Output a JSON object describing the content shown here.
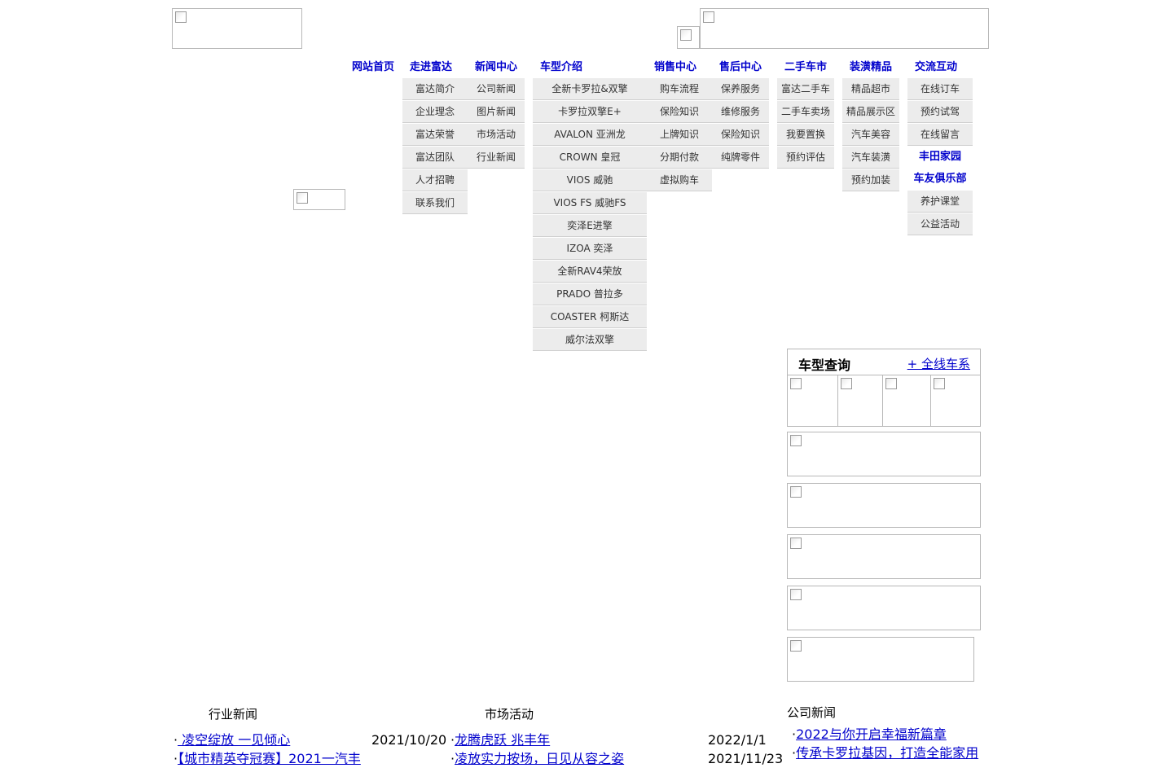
{
  "nav": {
    "top": [
      {
        "label": "网站首页"
      },
      {
        "label": "走进富达"
      },
      {
        "label": "新闻中心"
      },
      {
        "label": "车型介绍"
      },
      {
        "label": "销售中心"
      },
      {
        "label": "售后中心"
      },
      {
        "label": "二手车市"
      },
      {
        "label": "装潢精品"
      },
      {
        "label": "交流互动"
      }
    ],
    "menus": {
      "about": [
        "富达简介",
        "企业理念",
        "富达荣誉",
        "富达团队",
        "人才招聘",
        "联系我们"
      ],
      "news": [
        "公司新闻",
        "图片新闻",
        "市场活动",
        "行业新闻"
      ],
      "models": [
        "全新卡罗拉&双擎",
        "卡罗拉双擎E+",
        "AVALON 亚洲龙",
        "CROWN 皇冠",
        "VIOS 威驰",
        "VIOS FS 威驰FS",
        "奕泽E进擎",
        "IZOA 奕泽",
        "全新RAV4荣放",
        "PRADO 普拉多",
        "COASTER 柯斯达",
        "威尔法双擎"
      ],
      "sales": [
        "购车流程",
        "保险知识",
        "上牌知识",
        "分期付款",
        "虚拟购车"
      ],
      "service": [
        "保养服务",
        "维修服务",
        "保险知识",
        "纯牌零件"
      ],
      "used": [
        "富达二手车",
        "二手车卖场",
        "我要置换",
        "预约评估"
      ],
      "boutique": [
        "精品超市",
        "精品展示区",
        "汽车美容",
        "汽车装潢",
        "预约加装"
      ],
      "interact": [
        "在线订车",
        "预约试驾",
        "在线留言",
        "丰田家园",
        "车友俱乐部",
        "养护课堂",
        "公益活动"
      ]
    }
  },
  "models_panel": {
    "title": "车型查询",
    "link": "+ 全线车系"
  },
  "industry_news": {
    "title": "行业新闻",
    "items": [
      {
        "text": " 凌空绽放 一见倾心",
        "date": "2021/10/20"
      },
      {
        "text": "【城市精英夺冠赛】2021一汽丰",
        "date": ""
      }
    ]
  },
  "market_news": {
    "title": "市场活动",
    "items": [
      {
        "text": "龙腾虎跃 兆丰年",
        "date": "2022/1/1"
      },
      {
        "text": "凌放实力按场，日见从容之姿",
        "date": "2021/11/23"
      }
    ]
  },
  "company_news": {
    "title": "公司新闻",
    "items": [
      {
        "text": "2022与你开启幸福新篇章"
      },
      {
        "text": "传承卡罗拉基因，打造全能家用"
      }
    ]
  },
  "colors": {
    "link": "#0000cc",
    "menu_bg": "#ececec"
  }
}
